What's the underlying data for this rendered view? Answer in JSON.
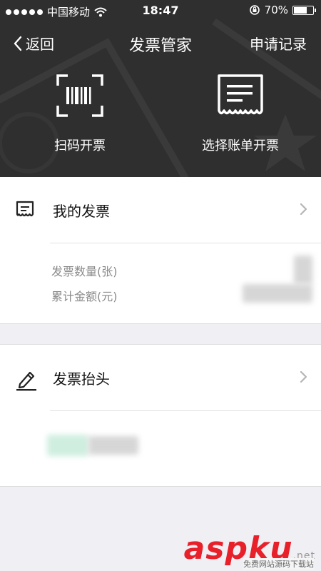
{
  "status_bar": {
    "carrier": "中国移动",
    "time": "18:47",
    "battery": "70%",
    "battery_level": 0.7
  },
  "nav": {
    "back_label": "返回",
    "title": "发票管家",
    "right_label": "申请记录"
  },
  "actions": {
    "scan_label": "扫码开票",
    "bill_label": "选择账单开票"
  },
  "invoices": {
    "label": "我的发票",
    "count_label": "发票数量(张)",
    "amount_label": "累计金额(元)"
  },
  "titles": {
    "label": "发票抬头"
  },
  "watermark": {
    "brand": "aspku",
    "domain": ".net",
    "sub": "免费网站源码下载站"
  },
  "colors": {
    "header_bg": "#2f2f2f",
    "page_bg": "#efeff4",
    "watermark": "#e8202a"
  }
}
